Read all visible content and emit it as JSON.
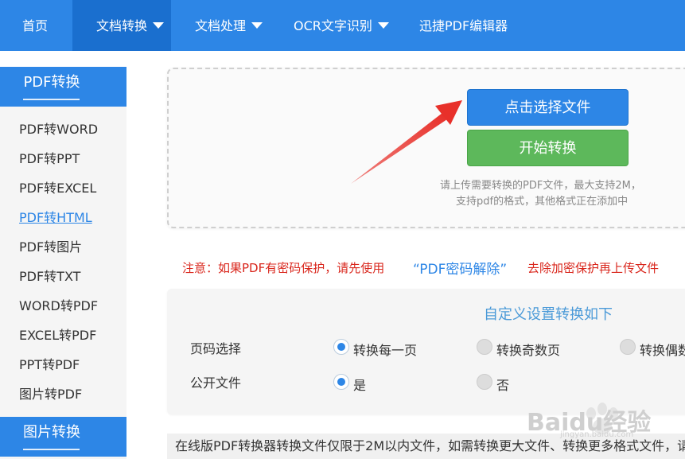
{
  "topnav": {
    "items": [
      {
        "label": "首页"
      },
      {
        "label": "文档转换"
      },
      {
        "label": "文档处理"
      },
      {
        "label": "OCR文字识别"
      },
      {
        "label": "迅捷PDF编辑器"
      }
    ],
    "active_index": 1
  },
  "sidebar": {
    "section1_title": "PDF转换",
    "items": [
      {
        "label": "PDF转WORD"
      },
      {
        "label": "PDF转PPT"
      },
      {
        "label": "PDF转EXCEL"
      },
      {
        "label": "PDF转HTML"
      },
      {
        "label": "PDF转图片"
      },
      {
        "label": "PDF转TXT"
      },
      {
        "label": "WORD转PDF"
      },
      {
        "label": "EXCEL转PDF"
      },
      {
        "label": "PPT转PDF"
      },
      {
        "label": "图片转PDF"
      }
    ],
    "active_item": "PDF转HTML",
    "section2_title": "图片转换"
  },
  "upload": {
    "select_button": "点击选择文件",
    "start_button": "开始转换",
    "hint_line1": "请上传需要转换的PDF文件，最大支持2M，",
    "hint_line2": "支持pdf的格式，其他格式正在添加中"
  },
  "notice": {
    "prefix": "注意：如果PDF有密码保护，请先使用",
    "link": "“PDF密码解除”",
    "suffix": "去除加密保护再上传文件"
  },
  "settings": {
    "title": "自定义设置转换如下",
    "page_label": "页码选择",
    "page_options": [
      "转换每一页",
      "转换奇数页",
      "转换偶数"
    ],
    "page_selected": "转换每一页",
    "public_label": "公开文件",
    "public_options": [
      "是",
      "否"
    ],
    "public_selected": "是"
  },
  "footer": {
    "text": "在线版PDF转换器转换文件仅限于2M以内文件，如需转换更大文件、转换更多格式文件，请"
  },
  "watermark": {
    "text": "Baidu经验",
    "sub": "jingyan.baidu.com"
  },
  "colors": {
    "primary": "#2d86e6",
    "success": "#5db85b",
    "danger": "#d9261c",
    "arrow": "#e8302a"
  }
}
